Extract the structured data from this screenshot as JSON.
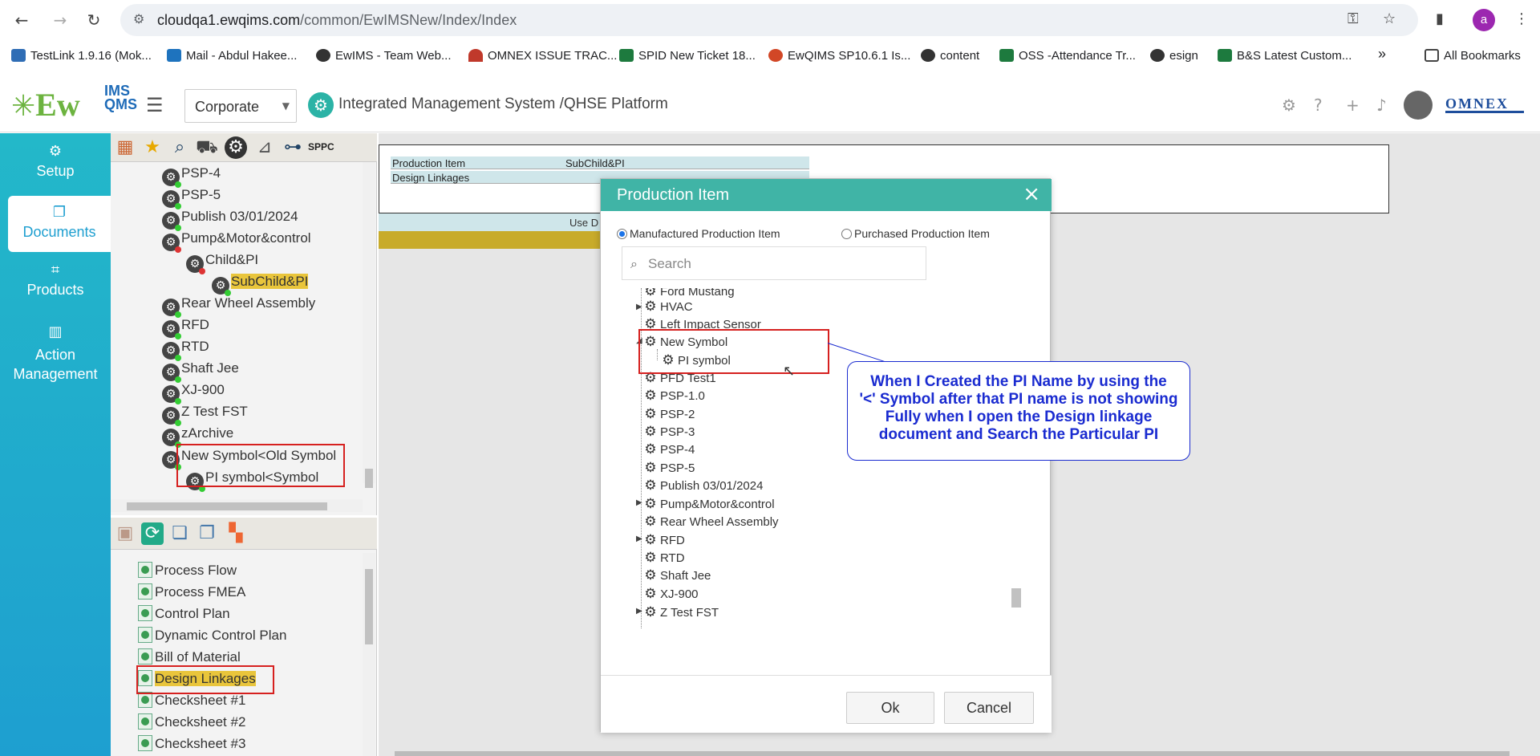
{
  "browser": {
    "url_host": "cloudqa1.ewqims.com",
    "url_path": "/common/EwIMSNew/Index/Index",
    "avatar_letter": "a",
    "bookmarks": [
      {
        "label": "TestLink 1.9.16 (Mok...",
        "color": "#2f6db5"
      },
      {
        "label": "Mail - Abdul Hakee...",
        "color": "#1e73be"
      },
      {
        "label": "EwIMS - Team Web...",
        "color": "#333333"
      },
      {
        "label": "OMNEX ISSUE TRAC...",
        "color": "#c0392b"
      },
      {
        "label": "SPID New Ticket 18...",
        "color": "#1d7a3e"
      },
      {
        "label": "EwQIMS SP10.6.1 Is...",
        "color": "#d24726"
      },
      {
        "label": "content",
        "color": "#333333"
      },
      {
        "label": "OSS -Attendance Tr...",
        "color": "#1d7a3e"
      },
      {
        "label": "esign",
        "color": "#333333"
      },
      {
        "label": "B&S Latest Custom...",
        "color": "#1d7a3e"
      }
    ],
    "more": "»",
    "all_bookmarks": "All Bookmarks"
  },
  "header": {
    "logo_main": "Ew",
    "logo_sub1": "IMS",
    "logo_sub2": "QMS",
    "site_select": "Corporate",
    "platform_title": "Integrated Management System /QHSE Platform",
    "brand": "OMNEX"
  },
  "left_nav": [
    {
      "label": "Setup",
      "icon": "gears-icon"
    },
    {
      "label": "Documents",
      "icon": "documents-icon"
    },
    {
      "label": "Products",
      "icon": "products-icon"
    },
    {
      "label": "Action Management",
      "icon": "building-icon"
    }
  ],
  "toolbar1": {
    "sppc_label": "SPPC"
  },
  "top_tree": [
    {
      "label": "PSP-4",
      "indent": 0
    },
    {
      "label": "PSP-5",
      "indent": 0
    },
    {
      "label": "Publish 03/01/2024",
      "indent": 0
    },
    {
      "label": "Pump&Motor&control",
      "indent": 0
    },
    {
      "label": "Child&PI",
      "indent": 1
    },
    {
      "label": "SubChild&PI",
      "indent": 2
    },
    {
      "label": "Rear Wheel Assembly",
      "indent": 0
    },
    {
      "label": "RFD",
      "indent": 0
    },
    {
      "label": "RTD",
      "indent": 0
    },
    {
      "label": "Shaft Jee",
      "indent": 0
    },
    {
      "label": "XJ-900",
      "indent": 0
    },
    {
      "label": "Z Test FST",
      "indent": 0
    },
    {
      "label": "zArchive",
      "indent": 0
    },
    {
      "label": "New Symbol<Old Symbol",
      "indent": 0
    },
    {
      "label": "PI symbol<Symbol",
      "indent": 1
    }
  ],
  "bottom_tree": [
    "Process Flow",
    "Process FMEA",
    "Control Plan",
    "Dynamic Control Plan",
    "Bill of Material",
    "Design Linkages",
    "Checksheet #1",
    "Checksheet #2",
    "Checksheet #3"
  ],
  "main": {
    "grid_row1_col1": "Production Item",
    "grid_row1_col2": "SubChild&PI",
    "grid_row2_col1": "Design Linkages",
    "use_label": "Use D"
  },
  "modal": {
    "title": "Production Item",
    "close": "×",
    "radio_manufactured": "Manufactured Production Item",
    "radio_purchased": "Purchased Production Item",
    "search_placeholder": "Search",
    "tree": [
      {
        "label": "Ford Mustang",
        "indent": 0,
        "expander": ""
      },
      {
        "label": "HVAC",
        "indent": 0,
        "expander": "▶"
      },
      {
        "label": "Left Impact Sensor",
        "indent": 0,
        "expander": ""
      },
      {
        "label": "New Symbol",
        "indent": 0,
        "expander": "◢"
      },
      {
        "label": "PI symbol",
        "indent": 1,
        "expander": ""
      },
      {
        "label": "PFD Test1",
        "indent": 0,
        "expander": ""
      },
      {
        "label": "PSP-1.0",
        "indent": 0,
        "expander": ""
      },
      {
        "label": "PSP-2",
        "indent": 0,
        "expander": ""
      },
      {
        "label": "PSP-3",
        "indent": 0,
        "expander": ""
      },
      {
        "label": "PSP-4",
        "indent": 0,
        "expander": ""
      },
      {
        "label": "PSP-5",
        "indent": 0,
        "expander": ""
      },
      {
        "label": "Publish 03/01/2024",
        "indent": 0,
        "expander": ""
      },
      {
        "label": "Pump&Motor&control",
        "indent": 0,
        "expander": "▶"
      },
      {
        "label": "Rear Wheel Assembly",
        "indent": 0,
        "expander": ""
      },
      {
        "label": "RFD",
        "indent": 0,
        "expander": "▶"
      },
      {
        "label": "RTD",
        "indent": 0,
        "expander": ""
      },
      {
        "label": "Shaft Jee",
        "indent": 0,
        "expander": ""
      },
      {
        "label": "XJ-900",
        "indent": 0,
        "expander": ""
      },
      {
        "label": "Z Test FST",
        "indent": 0,
        "expander": "▶"
      }
    ],
    "ok_label": "Ok",
    "cancel_label": "Cancel"
  },
  "callout": {
    "line1": "When I Created the PI Name by using the",
    "line2": "'<' Symbol after that PI name is not showing",
    "line3": "Fully when I open the Design linkage",
    "line4": "document and Search the Particular PI"
  },
  "colors": {
    "accent_teal": "#40b4a6",
    "nav_gradient": "#23b8c9",
    "highlight_yellow": "#e9c53b",
    "annotation_red": "#d6201f",
    "callout_blue": "#1a2bd0"
  }
}
